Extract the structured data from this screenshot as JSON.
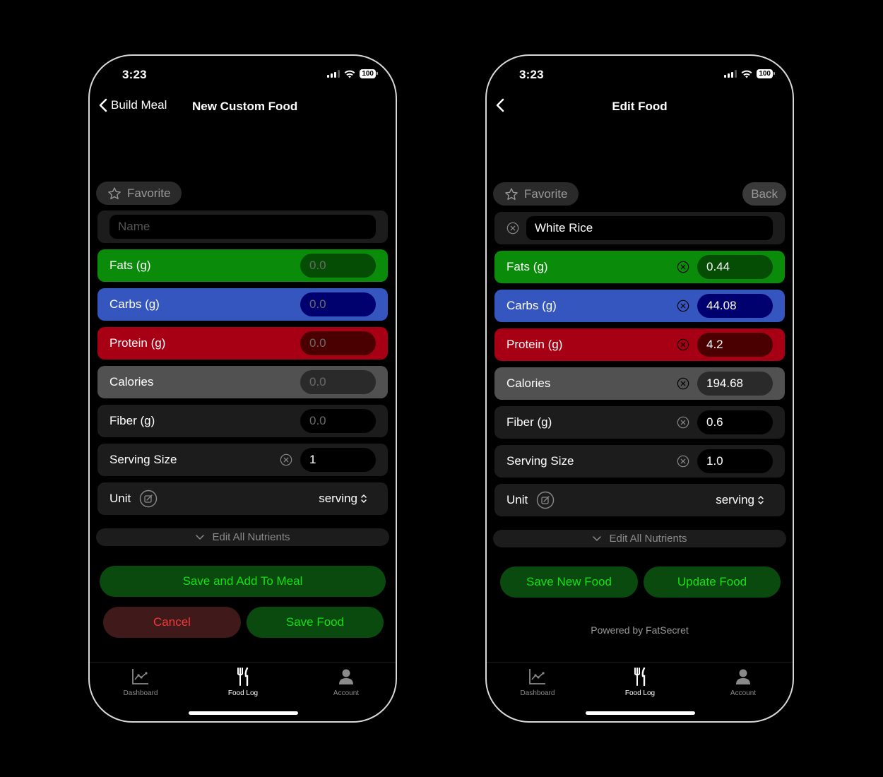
{
  "left_screen": {
    "status": {
      "time": "3:23",
      "battery": "100"
    },
    "nav": {
      "back_label": "Build Meal",
      "title": "New Custom Food"
    },
    "favorite_label": "Favorite",
    "name_field": {
      "value": "",
      "placeholder": "Name"
    },
    "fields": [
      {
        "label": "Fats (g)",
        "value": "",
        "placeholder": "0.0",
        "color": "#0a8c0a"
      },
      {
        "label": "Carbs (g)",
        "value": "",
        "placeholder": "0.0",
        "color": "#3556bf"
      },
      {
        "label": "Protein (g)",
        "value": "",
        "placeholder": "0.0",
        "color": "#a70015"
      },
      {
        "label": "Calories",
        "value": "",
        "placeholder": "0.0",
        "color": "#515151"
      },
      {
        "label": "Fiber (g)",
        "value": "",
        "placeholder": "0.0"
      },
      {
        "label": "Serving Size",
        "value": "1"
      }
    ],
    "unit": {
      "label": "Unit",
      "value": "serving"
    },
    "edit_all_label": "Edit All Nutrients",
    "buttons": {
      "save_add": "Save and Add To Meal",
      "cancel": "Cancel",
      "save_food": "Save Food"
    },
    "tabs": [
      {
        "label": "Dashboard",
        "icon": "chart-line-icon",
        "active": false
      },
      {
        "label": "Food Log",
        "icon": "fork-knife-icon",
        "active": true
      },
      {
        "label": "Account",
        "icon": "person-icon",
        "active": false
      }
    ]
  },
  "right_screen": {
    "status": {
      "time": "3:23",
      "battery": "100"
    },
    "nav": {
      "title": "Edit Food"
    },
    "favorite_label": "Favorite",
    "back_label": "Back",
    "name_field": {
      "value": "White Rice",
      "placeholder": "Name"
    },
    "fields": [
      {
        "label": "Fats (g)",
        "value": "0.44",
        "color": "#0a8c0a"
      },
      {
        "label": "Carbs (g)",
        "value": "44.08",
        "color": "#3556bf"
      },
      {
        "label": "Protein (g)",
        "value": "4.2",
        "color": "#a70015"
      },
      {
        "label": "Calories",
        "value": "194.68",
        "color": "#515151"
      },
      {
        "label": "Fiber (g)",
        "value": "0.6"
      },
      {
        "label": "Serving Size",
        "value": "1.0"
      }
    ],
    "unit": {
      "label": "Unit",
      "value": "serving"
    },
    "edit_all_label": "Edit All Nutrients",
    "buttons": {
      "save_new": "Save New Food",
      "update": "Update Food"
    },
    "powered_by": "Powered by FatSecret",
    "tabs": [
      {
        "label": "Dashboard",
        "icon": "chart-line-icon",
        "active": false
      },
      {
        "label": "Food Log",
        "icon": "fork-knife-icon",
        "active": true
      },
      {
        "label": "Account",
        "icon": "person-icon",
        "active": false
      }
    ]
  }
}
